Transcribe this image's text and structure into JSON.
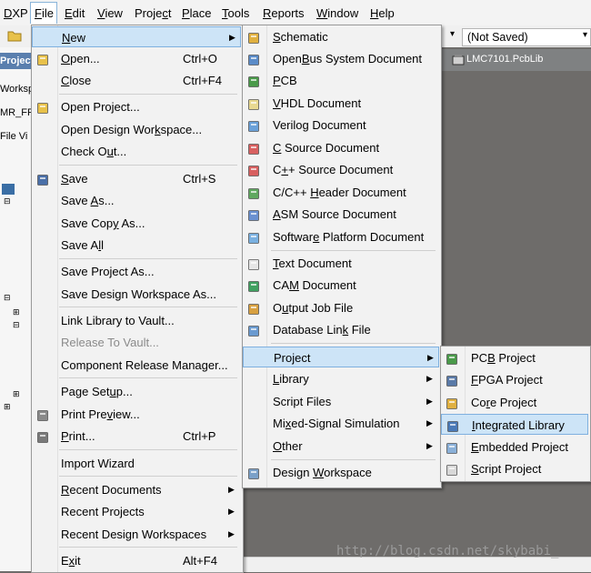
{
  "menubar": {
    "items": [
      {
        "label": "DXP",
        "u": "D"
      },
      {
        "label": "File",
        "u": "F"
      },
      {
        "label": "Edit",
        "u": "E"
      },
      {
        "label": "View",
        "u": "V"
      },
      {
        "label": "Project",
        "u": "c"
      },
      {
        "label": "Place",
        "u": "P"
      },
      {
        "label": "Tools",
        "u": "T"
      },
      {
        "label": "Reports",
        "u": "R"
      },
      {
        "label": "Window",
        "u": "W"
      },
      {
        "label": "Help",
        "u": "H"
      }
    ]
  },
  "toolbar": {
    "combo_value": "(Not Saved)"
  },
  "doc_tab": {
    "label": "LMC7101.PcbLib"
  },
  "left_panel": {
    "projects_label": "Projects",
    "workspace_label": "Worksp",
    "project_label": "MR_FP",
    "file_view_label": "File Vi"
  },
  "file_menu": {
    "items": [
      {
        "label": "New",
        "u": "N",
        "arrow": true,
        "highlighted": true
      },
      {
        "label": "Open...",
        "u": "O",
        "shortcut": "Ctrl+O",
        "icon": "folder-open-icon"
      },
      {
        "label": "Close",
        "u": "C",
        "shortcut": "Ctrl+F4"
      },
      {
        "label": "Open Project...",
        "u": "j",
        "icon": "folder-open-icon"
      },
      {
        "label": "Open Design Workspace...",
        "u": "k"
      },
      {
        "label": "Check Out...",
        "u": "u"
      },
      {
        "label": "Save",
        "u": "S",
        "shortcut": "Ctrl+S",
        "icon": "save-icon"
      },
      {
        "label": "Save As...",
        "u": "A"
      },
      {
        "label": "Save Copy As...",
        "u": "y"
      },
      {
        "label": "Save All",
        "u": "l"
      },
      {
        "label": "Save Project As...",
        "u": ""
      },
      {
        "label": "Save Design Workspace As...",
        "u": ""
      },
      {
        "label": "Link Library to Vault...",
        "u": ""
      },
      {
        "label": "Release To Vault...",
        "u": "",
        "disabled": true
      },
      {
        "label": "Component Release Manager...",
        "u": ""
      },
      {
        "label": "Page Setup...",
        "u": "u"
      },
      {
        "label": "Print Preview...",
        "u": "v",
        "icon": "print-preview-icon"
      },
      {
        "label": "Print...",
        "u": "P",
        "shortcut": "Ctrl+P",
        "icon": "printer-icon"
      },
      {
        "label": "Import Wizard",
        "u": ""
      },
      {
        "label": "Recent Documents",
        "u": "R",
        "arrow": true
      },
      {
        "label": "Recent Projects",
        "u": "",
        "arrow": true
      },
      {
        "label": "Recent Design Workspaces",
        "u": "",
        "arrow": true
      },
      {
        "label": "Exit",
        "u": "x",
        "shortcut": "Alt+F4"
      }
    ]
  },
  "new_menu": {
    "items": [
      {
        "label": "Schematic",
        "u": "S",
        "icon": "schematic-icon"
      },
      {
        "label": "OpenBus System Document",
        "u": "B",
        "icon": "openbus-icon"
      },
      {
        "label": "PCB",
        "u": "P",
        "icon": "pcb-icon"
      },
      {
        "label": "VHDL Document",
        "u": "V",
        "icon": "vhdl-icon"
      },
      {
        "label": "Verilog Document",
        "u": "g",
        "icon": "verilog-icon"
      },
      {
        "label": "C Source Document",
        "u": "C",
        "icon": "c-source-icon"
      },
      {
        "label": "C++ Source Document",
        "u": "+",
        "icon": "cpp-source-icon"
      },
      {
        "label": "C/C++ Header Document",
        "u": "H",
        "icon": "header-icon"
      },
      {
        "label": "ASM Source Document",
        "u": "A",
        "icon": "asm-icon"
      },
      {
        "label": "Software Platform Document",
        "u": "e",
        "icon": "software-platform-icon"
      },
      {
        "label": "Text Document",
        "u": "T",
        "icon": "text-doc-icon"
      },
      {
        "label": "CAM Document",
        "u": "M",
        "icon": "cam-icon"
      },
      {
        "label": "Output Job File",
        "u": "u",
        "icon": "output-job-icon"
      },
      {
        "label": "Database Link File",
        "u": "k",
        "icon": "database-link-icon"
      },
      {
        "label": "Project",
        "u": "",
        "arrow": true,
        "highlighted": true
      },
      {
        "label": "Library",
        "u": "L",
        "arrow": true
      },
      {
        "label": "Script Files",
        "u": "",
        "arrow": true
      },
      {
        "label": "Mixed-Signal Simulation",
        "u": "x",
        "arrow": true
      },
      {
        "label": "Other",
        "u": "O",
        "arrow": true
      },
      {
        "label": "Design Workspace",
        "u": "W",
        "icon": "workspace-icon"
      }
    ]
  },
  "project_menu": {
    "items": [
      {
        "label": "PCB Project",
        "u": "B",
        "icon": "pcb-project-icon"
      },
      {
        "label": "FPGA Project",
        "u": "F",
        "icon": "fpga-project-icon"
      },
      {
        "label": "Core Project",
        "u": "r",
        "icon": "core-project-icon"
      },
      {
        "label": "Integrated Library",
        "u": "I",
        "icon": "integrated-library-icon",
        "highlighted": true
      },
      {
        "label": "Embedded Project",
        "u": "E",
        "icon": "embedded-project-icon"
      },
      {
        "label": "Script Project",
        "u": "S",
        "icon": "script-project-icon"
      }
    ]
  },
  "watermark": "http://blog.csdn.net/skybabi_"
}
